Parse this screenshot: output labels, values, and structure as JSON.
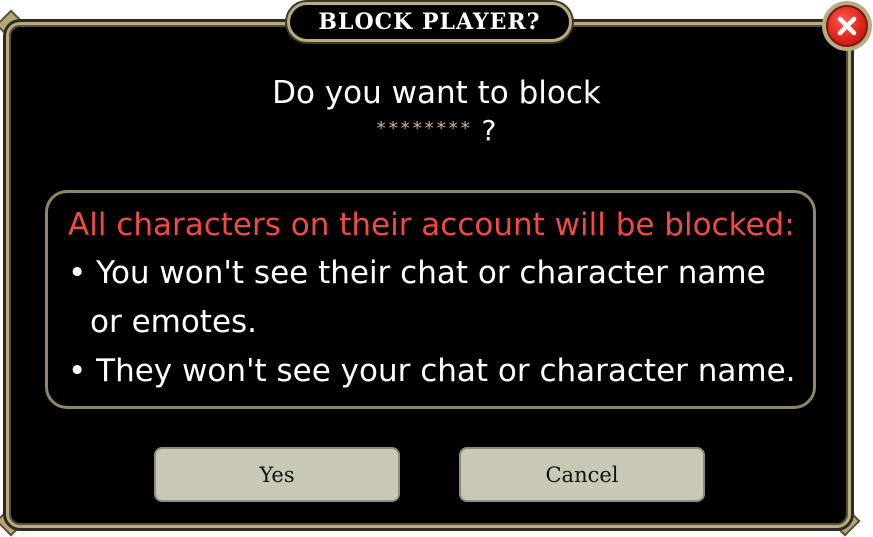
{
  "dialog": {
    "title": "BLOCK PLAYER?",
    "question_line1": "Do you want to block",
    "player_name": "********",
    "question_mark": " ?",
    "warning": "All characters on their account will be blocked:",
    "bullet1_line1": "• You won't see their chat or character name",
    "bullet1_line2": "or emotes.",
    "bullet2": "• They won't see your chat or character name.",
    "yes_label": "Yes",
    "cancel_label": "Cancel",
    "close_icon": "close-x-icon"
  },
  "colors": {
    "frame_gold": "#b9ac80",
    "warning_red": "#f04a48",
    "button_bg": "#c8c8b4",
    "close_red": "#e0261c"
  }
}
